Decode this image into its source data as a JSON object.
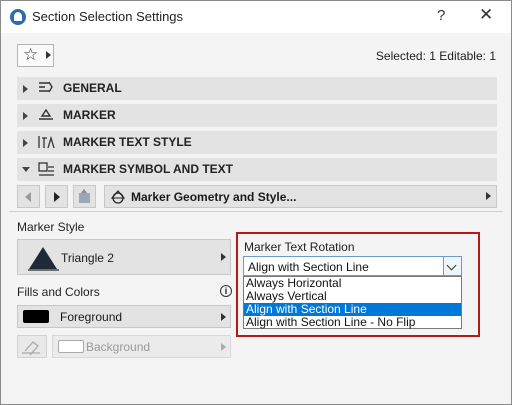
{
  "window": {
    "title": "Section Selection Settings",
    "help_label": "?",
    "close_label": "✕"
  },
  "toolbar": {
    "favorites_icon": "star-icon",
    "selected_info": "Selected: 1 Editable: 1"
  },
  "panels": [
    {
      "label": "GENERAL",
      "icon": "general-icon",
      "expanded": false
    },
    {
      "label": "MARKER",
      "icon": "marker-icon",
      "expanded": false
    },
    {
      "label": "MARKER TEXT STYLE",
      "icon": "text-style-icon",
      "expanded": false
    },
    {
      "label": "MARKER SYMBOL AND TEXT",
      "icon": "symbol-text-icon",
      "expanded": true
    }
  ],
  "page_nav": {
    "page_label": "Marker Geometry and Style..."
  },
  "marker_style": {
    "label": "Marker Style",
    "value": "Triangle 2"
  },
  "fills": {
    "label": "Fills and Colors",
    "foreground": "Foreground",
    "background": "Background",
    "foreground_color": "#000000"
  },
  "rotation": {
    "label": "Marker Text Rotation",
    "value": "Align with Section Line",
    "options": [
      "Always Horizontal",
      "Always Vertical",
      "Align with Section Line",
      "Align with Section Line - No Flip"
    ],
    "selected_index": 2
  },
  "colors": {
    "highlight": "#0078d7",
    "frame": "#b31b1b",
    "panel": "#e3e3e3"
  }
}
